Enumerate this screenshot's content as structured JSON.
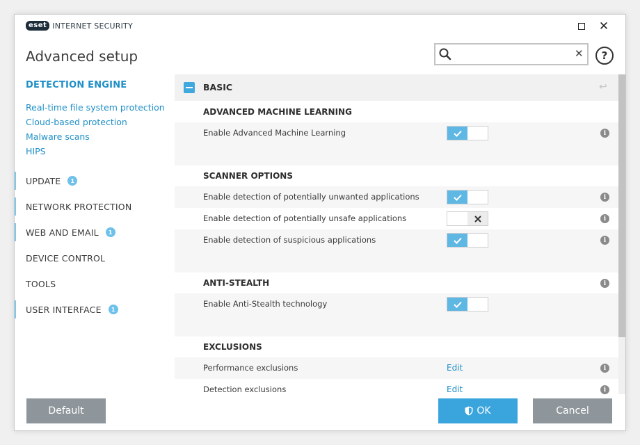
{
  "app": {
    "logo_badge": "eset",
    "logo_text": "INTERNET SECURITY",
    "title": "Advanced setup"
  },
  "search": {
    "value": "",
    "placeholder": ""
  },
  "sidebar": {
    "active": "DETECTION ENGINE",
    "sub_items": [
      "Real-time file system protection",
      "Cloud-based protection",
      "Malware scans",
      "HIPS"
    ],
    "items": [
      {
        "label": "UPDATE",
        "badge": "1"
      },
      {
        "label": "NETWORK PROTECTION"
      },
      {
        "label": "WEB AND EMAIL",
        "badge": "1"
      },
      {
        "label": "DEVICE CONTROL"
      },
      {
        "label": "TOOLS"
      },
      {
        "label": "USER INTERFACE",
        "badge": "1"
      }
    ]
  },
  "content": {
    "section": "BASIC",
    "groups": {
      "aml": {
        "title": "ADVANCED MACHINE LEARNING",
        "rows": [
          {
            "label": "Enable Advanced Machine Learning",
            "enabled": true
          }
        ]
      },
      "scanner": {
        "title": "SCANNER OPTIONS",
        "rows": [
          {
            "label": "Enable detection of potentially unwanted applications",
            "enabled": true
          },
          {
            "label": "Enable detection of potentially unsafe applications",
            "enabled": false
          },
          {
            "label": "Enable detection of suspicious applications",
            "enabled": true
          }
        ]
      },
      "antistealth": {
        "title": "ANTI-STEALTH",
        "rows": [
          {
            "label": "Enable Anti-Stealth technology",
            "enabled": true
          }
        ]
      },
      "exclusions": {
        "title": "EXCLUSIONS",
        "rows": [
          {
            "label": "Performance exclusions",
            "action": "Edit"
          },
          {
            "label": "Detection exclusions",
            "action": "Edit"
          }
        ]
      }
    }
  },
  "footer": {
    "default_label": "Default",
    "ok_label": "OK",
    "cancel_label": "Cancel"
  },
  "colors": {
    "accent": "#1f8fc7",
    "toggle_on": "#5fb7e3",
    "button_primary": "#3aa4dc",
    "button_secondary": "#8e969b"
  }
}
